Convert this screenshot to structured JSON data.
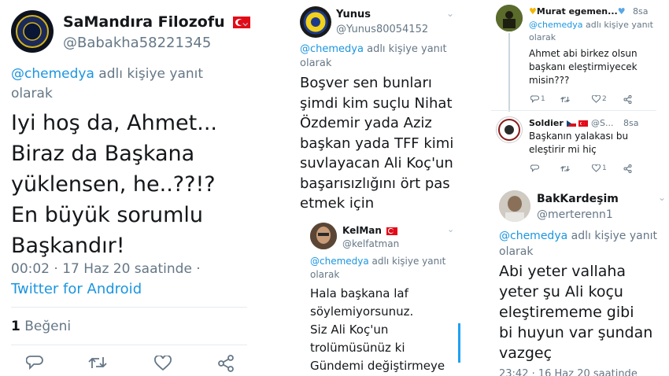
{
  "t1": {
    "name": "SaMandıra Filozofu",
    "handle": "@Babakha58221345",
    "reply_mention": "@chemedya",
    "reply_rest": " adlı kişiye yanıt olarak",
    "body_lines": [
      "Iyi hoş da, Ahmet...",
      "Biraz da Başkana",
      "yüklensen, he..??!?",
      "En büyük sorumlu",
      "Başkandır!"
    ],
    "time": "00:02 · 17 Haz 20 saatinde ·",
    "client": "Twitter for Android",
    "likes_count": "1",
    "likes_label": " Beğeni"
  },
  "t2": {
    "name": "Yunus",
    "handle": "@Yunus80054152",
    "reply_mention": "@chemedya",
    "reply_rest": " adlı kişiye yanıt olarak",
    "body_lines": [
      "Boşver sen bunları",
      "şimdi kim suçlu Nihat",
      "Özdemir yada Aziz",
      "başkan yada TFF kimi",
      "suvlayacan Ali Koç'un",
      "başarısızlığını ört pas",
      "etmek için"
    ]
  },
  "t3": {
    "name": "KelMan",
    "handle": "@kelfatman",
    "reply_mention": "@chemedya",
    "reply_rest": " adlı kişiye yanıt olarak",
    "body_lines": [
      "Hala başkana laf",
      "söylemiyorsunuz.",
      "Siz Ali Koç'un",
      "trolümüsünüz ki",
      "Gündemi değiştirmeye"
    ]
  },
  "t4": {
    "name": "Murat egemen...",
    "age": "8sa",
    "reply_mention": "@chemedya",
    "reply_rest": " adlı kişiye yanıt olarak",
    "body_lines": [
      "Ahmet abi birkez olsun",
      "başkanı eleştirmiyecek",
      "misin???"
    ],
    "replies": "1",
    "likes": "2"
  },
  "t5": {
    "name": "Soldier",
    "handle": "@S...",
    "age": "8sa",
    "body_lines": [
      "Başkanın yalakası bu",
      "eleştirir mi hiç"
    ],
    "likes": "1"
  },
  "t6": {
    "name": "BakKardeşim",
    "handle": "@merterenn1",
    "reply_mention": "@chemedya",
    "reply_rest": " adlı kişiye yanıt olarak",
    "body_lines": [
      "Abi yeter vallaha",
      "yeter şu Ali koçu",
      "eleştirememe gibi",
      "bi huyun var şundan",
      "vazgeç"
    ],
    "time": "23:42 · 16 Haz 20 saatinde"
  },
  "colors": {
    "link": "#1b95e0",
    "muted": "#657786",
    "text": "#14171a",
    "flag_red": "#e30a17"
  }
}
